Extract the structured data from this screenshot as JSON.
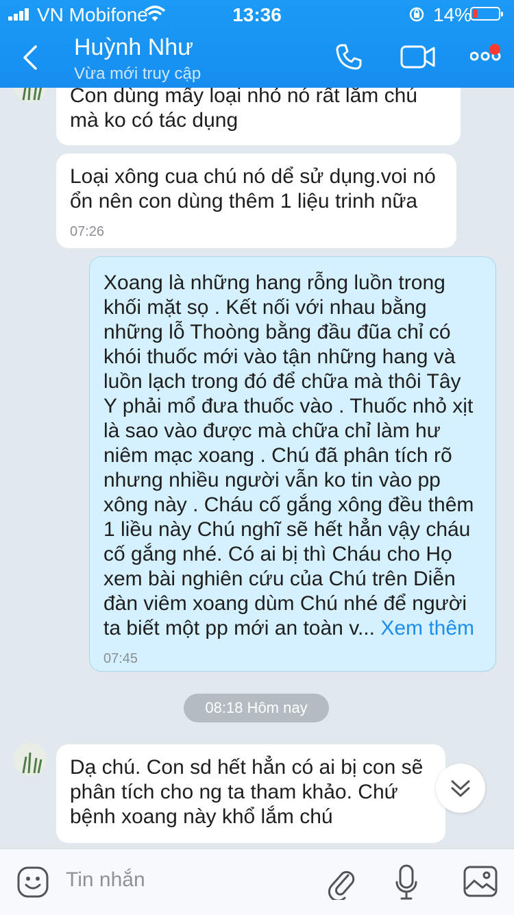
{
  "status_bar": {
    "carrier": "VN Mobifone",
    "time": "13:36",
    "battery_percent": "14%"
  },
  "header": {
    "contact_name": "Huỳnh Như",
    "presence": "Vừa mới truy cập",
    "back_icon": "chevron-left-icon",
    "call_icon": "phone-icon",
    "video_icon": "video-icon",
    "menu_icon": "more-icon",
    "notification_dot_color": "#ff3b30"
  },
  "messages": [
    {
      "sender": "contact",
      "lines": [
        "Con dùng mấy loại nhỏ nó rất lăm chú",
        "mà ko có tác dụng"
      ],
      "time": ""
    },
    {
      "sender": "contact",
      "lines": [
        "Loại xông cua chú nó dể sử dụng.voi nó",
        "ổn nên con dùng thêm 1 liệu trinh nữa"
      ],
      "time": "07:26"
    },
    {
      "sender": "me",
      "lines": [
        "Xoang là những hang rỗng luồn trong",
        "khối mặt sọ . Kết nối với nhau bằng",
        "những lỗ Thoòng bằng đầu đũa chỉ có",
        "khói thuốc mới vào tận những hang và",
        "luồn lạch trong đó để chữa mà thôi Tây",
        "Y phải mổ đưa thuốc vào . Thuốc nhỏ xịt",
        "là sao vào được mà chữa chỉ làm hư",
        "niêm mạc xoang . Chú đã phân tích rõ",
        "nhưng nhiều người vẫn ko tin vào pp",
        "xông này . Cháu cố gắng xông đều thêm",
        "1 liều này Chú nghĩ sẽ hết hẳn vậy cháu",
        "cố gắng nhé. Có ai bị thì Cháu cho Họ",
        "xem bài nghiên cứu của Chú trên Diễn",
        "đàn viêm xoang dùm Chú nhé để người"
      ],
      "last_line": "ta biết một pp mới an toàn v...",
      "see_more": "Xem thêm",
      "time": "07:45"
    },
    {
      "sender": "contact",
      "lines": [
        "Dạ chú. Con sd hết hẳn có ai bị con sẽ",
        "phân tích cho ng ta tham khảo. Chứ",
        "bệnh xoang này khổ lắm chú"
      ],
      "time": ""
    }
  ],
  "date_separator": "08:18 Hôm nay",
  "composer": {
    "placeholder": "Tin nhắn",
    "emoji_icon": "emoji-icon",
    "attach_icon": "paperclip-icon",
    "mic_icon": "microphone-icon",
    "image_icon": "image-icon"
  },
  "scroll_down_icon": "double-chevron-down-icon",
  "colors": {
    "header": "#1b9af7",
    "chat_bg": "#e1e8ee",
    "my_bubble": "#d5f1ff",
    "link": "#1b8ff0"
  }
}
